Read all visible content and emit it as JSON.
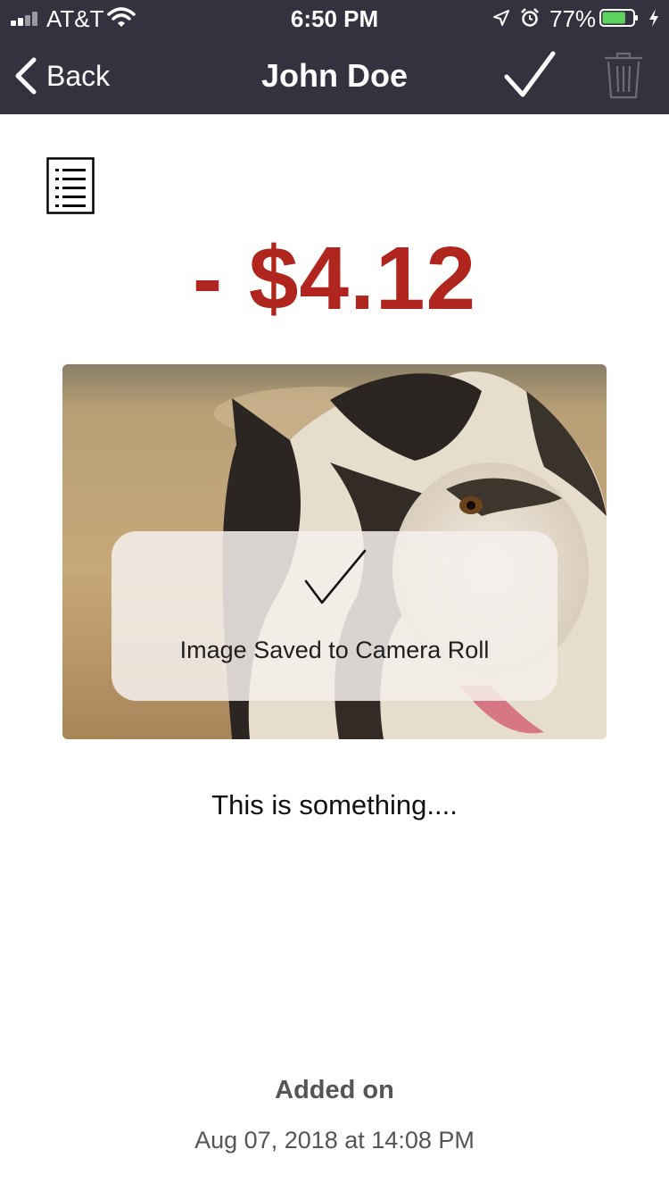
{
  "status_bar": {
    "carrier": "AT&T",
    "time": "6:50 PM",
    "battery_percent": "77%",
    "battery_level": 0.77,
    "battery_color": "#5fd35f"
  },
  "nav": {
    "back_label": "Back",
    "title": "John Doe",
    "confirm_icon": "checkmark-icon",
    "delete_icon": "trash-icon"
  },
  "transaction": {
    "details_icon": "list-icon",
    "amount": "- $4.12",
    "amount_color": "#b0261f",
    "photo": "dog-photo",
    "caption": "This is something...."
  },
  "toast": {
    "message": "Image Saved to Camera Roll"
  },
  "footer": {
    "added_label": "Added on",
    "added_date": "Aug 07, 2018 at 14:08 PM"
  }
}
